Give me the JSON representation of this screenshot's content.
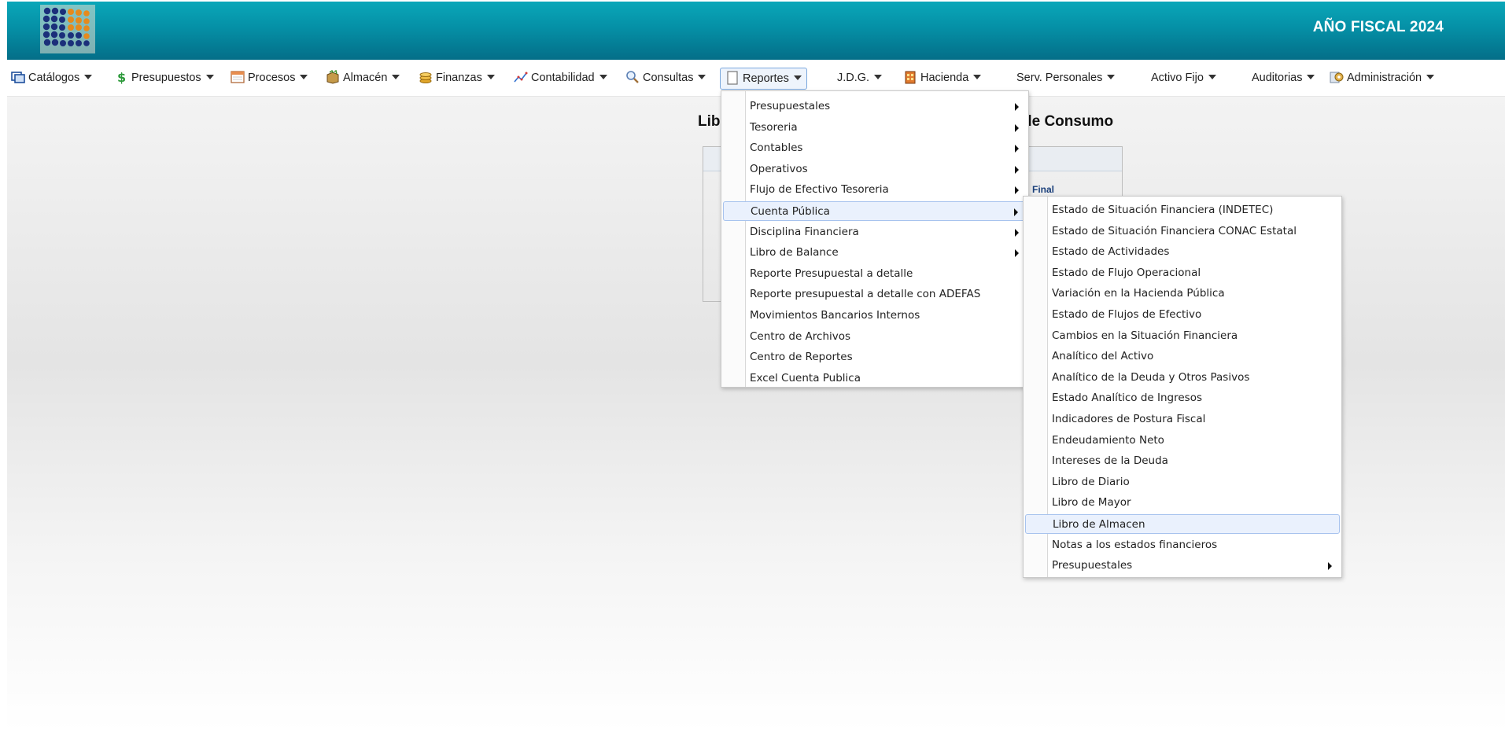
{
  "header": {
    "fiscal_year_label": "AÑO FISCAL  2024"
  },
  "menubar": {
    "items": [
      {
        "label": "Catálogos",
        "icon": "catalog-icon"
      },
      {
        "label": "Presupuestos",
        "icon": "money-icon"
      },
      {
        "label": "Procesos",
        "icon": "calendar-icon"
      },
      {
        "label": "Almacén",
        "icon": "box-icon"
      },
      {
        "label": "Finanzas",
        "icon": "coins-icon"
      },
      {
        "label": "Contabilidad",
        "icon": "chart-icon"
      },
      {
        "label": "Consultas",
        "icon": "search-icon"
      },
      {
        "label": "Reportes",
        "icon": "document-icon"
      },
      {
        "label": "J.D.G.",
        "icon": ""
      },
      {
        "label": "Hacienda",
        "icon": "building-icon"
      },
      {
        "label": "Serv. Personales",
        "icon": ""
      },
      {
        "label": "Activo Fijo",
        "icon": ""
      },
      {
        "label": "Auditorias",
        "icon": ""
      },
      {
        "label": "Administración",
        "icon": "admin-icon"
      }
    ]
  },
  "background_page": {
    "title_left": "Lib",
    "title_right": "de Consumo",
    "panel_label": "Final"
  },
  "reportes_menu": {
    "items": [
      {
        "label": "Presupuestales",
        "submenu": true
      },
      {
        "label": "Tesoreria",
        "submenu": true
      },
      {
        "label": "Contables",
        "submenu": true
      },
      {
        "label": "Operativos",
        "submenu": true
      },
      {
        "label": "Flujo de Efectivo Tesoreria",
        "submenu": true
      },
      {
        "label": "Cuenta Pública",
        "submenu": true,
        "highlighted": true
      },
      {
        "label": "Disciplina Financiera",
        "submenu": true
      },
      {
        "label": "Libro de Balance",
        "submenu": true
      },
      {
        "label": "Reporte Presupuestal a detalle",
        "submenu": false
      },
      {
        "label": "Reporte presupuestal a detalle con ADEFAS",
        "submenu": false
      },
      {
        "label": "Movimientos Bancarios Internos",
        "submenu": false
      },
      {
        "label": "Centro de Archivos",
        "submenu": false
      },
      {
        "label": "Centro de Reportes",
        "submenu": false
      },
      {
        "label": "Excel Cuenta Publica",
        "submenu": false
      }
    ]
  },
  "cuenta_publica_menu": {
    "items": [
      {
        "label": "Estado de Situación Financiera (INDETEC)",
        "submenu": false
      },
      {
        "label": "Estado de Situación Financiera CONAC Estatal",
        "submenu": false
      },
      {
        "label": "Estado de Actividades",
        "submenu": false
      },
      {
        "label": "Estado de Flujo Operacional",
        "submenu": false
      },
      {
        "label": "Variación en la Hacienda Pública",
        "submenu": false
      },
      {
        "label": "Estado de Flujos de Efectivo",
        "submenu": false
      },
      {
        "label": "Cambios en la Situación Financiera",
        "submenu": false
      },
      {
        "label": "Analítico del Activo",
        "submenu": false
      },
      {
        "label": "Analítico de la Deuda y Otros Pasivos",
        "submenu": false
      },
      {
        "label": "Estado Analítico de Ingresos",
        "submenu": false
      },
      {
        "label": "Indicadores de Postura Fiscal",
        "submenu": false
      },
      {
        "label": "Endeudamiento Neto",
        "submenu": false
      },
      {
        "label": "Intereses de la Deuda",
        "submenu": false
      },
      {
        "label": "Libro de Diario",
        "submenu": false
      },
      {
        "label": "Libro de Mayor",
        "submenu": false
      },
      {
        "label": "Libro de Almacen",
        "submenu": false,
        "highlighted": true
      },
      {
        "label": "Notas a los estados financieros",
        "submenu": false
      },
      {
        "label": "Presupuestales",
        "submenu": true
      }
    ]
  },
  "colors": {
    "header": "#0590a6",
    "highlight": "#eaf1fd",
    "highlight_border": "#a7c3ee"
  }
}
